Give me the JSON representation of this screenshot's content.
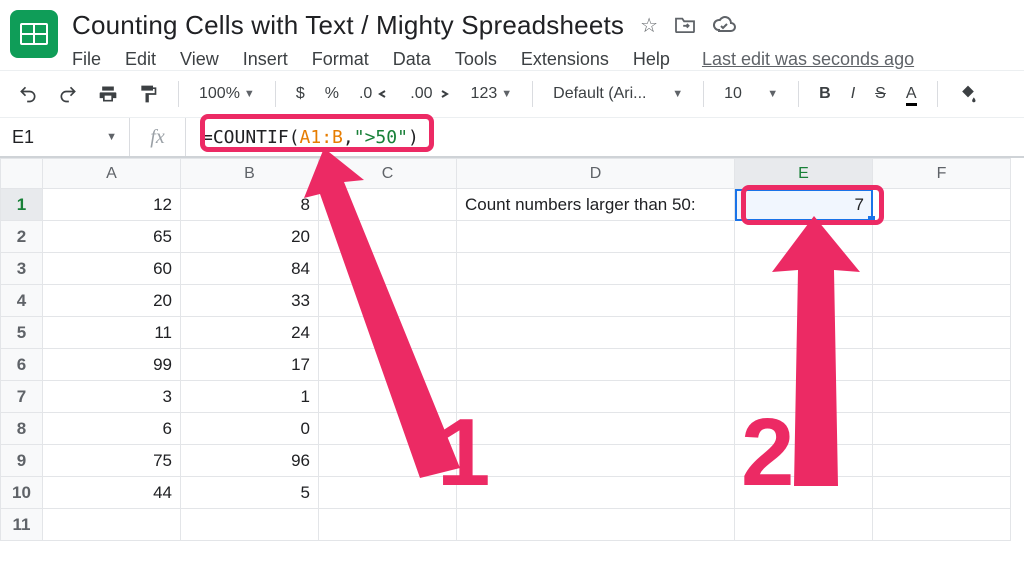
{
  "doc": {
    "title": "Counting Cells with Text / Mighty Spreadsheets",
    "last_edit": "Last edit was seconds ago"
  },
  "menu": {
    "file": "File",
    "edit": "Edit",
    "view": "View",
    "insert": "Insert",
    "format": "Format",
    "data": "Data",
    "tools": "Tools",
    "extensions": "Extensions",
    "help": "Help"
  },
  "toolbar": {
    "zoom": "100%",
    "currency": "$",
    "percent": "%",
    "dec_dec": ".0",
    "dec_inc": ".00",
    "numfmt": "123",
    "font": "Default (Ari...",
    "font_size": "10",
    "bold": "B",
    "italic": "I",
    "strike": "S",
    "textcolor": "A"
  },
  "name_box": "E1",
  "fx_label": "fx",
  "formula": {
    "prefix": "=COUNTIF(",
    "ref": "A1:B",
    "mid": ",",
    "str": "\">50\"",
    "suffix": ")"
  },
  "columns": [
    "A",
    "B",
    "C",
    "D",
    "E",
    "F"
  ],
  "rows": [
    "1",
    "2",
    "3",
    "4",
    "5",
    "6",
    "7",
    "8",
    "9",
    "10",
    "11"
  ],
  "cells": {
    "A": [
      "12",
      "65",
      "60",
      "20",
      "11",
      "99",
      "3",
      "6",
      "75",
      "44",
      ""
    ],
    "B": [
      "8",
      "20",
      "84",
      "33",
      "24",
      "17",
      "1",
      "0",
      "96",
      "5",
      ""
    ]
  },
  "d1_label": "Count numbers larger than 50:",
  "e1_value": "7",
  "annotations": {
    "label1": "1",
    "label2": "2"
  },
  "colors": {
    "highlight": "#ec2a64",
    "ref": "#e67c00",
    "str": "#188038"
  }
}
